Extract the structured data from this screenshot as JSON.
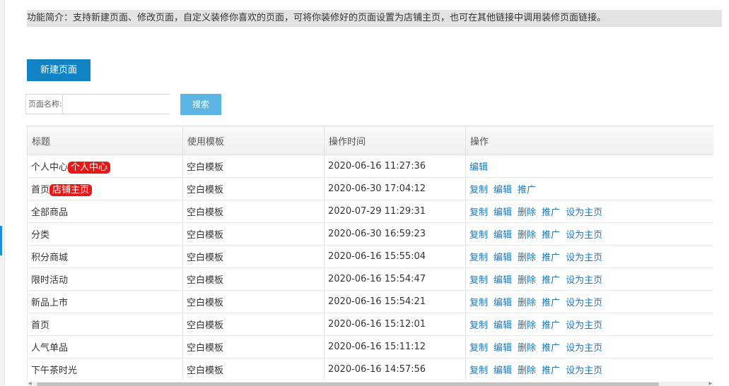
{
  "intro": {
    "text": "功能简介：支持新建页面、修改页面，自定义装修你喜欢的页面，可将你装修好的页面设置为店铺主页，也可在其他链接中调用装修页面链接。"
  },
  "toolbar": {
    "new_page_label": "新建页面"
  },
  "search": {
    "label": "页面名称:",
    "value": "",
    "button_label": "搜索"
  },
  "table": {
    "headers": {
      "title": "标题",
      "template": "使用模板",
      "time": "操作时间",
      "ops": "操作"
    },
    "rows": [
      {
        "title": "个人中心",
        "badge": "个人中心",
        "template": "空白模板",
        "time": "2020-06-16 11:27:36",
        "ops": [
          "编辑"
        ]
      },
      {
        "title": "首页",
        "badge": "店铺主页",
        "template": "空白模板",
        "time": "2020-06-30 17:04:12",
        "ops": [
          "复制",
          "编辑",
          "推广"
        ]
      },
      {
        "title": "全部商品",
        "badge": "",
        "template": "空白模板",
        "time": "2020-07-29 11:29:31",
        "ops": [
          "复制",
          "编辑",
          "删除",
          "推广",
          "设为主页"
        ]
      },
      {
        "title": "分类",
        "badge": "",
        "template": "空白模板",
        "time": "2020-06-30 16:59:23",
        "ops": [
          "复制",
          "编辑",
          "删除",
          "推广",
          "设为主页"
        ]
      },
      {
        "title": "积分商城",
        "badge": "",
        "template": "空白模板",
        "time": "2020-06-16 15:55:04",
        "ops": [
          "复制",
          "编辑",
          "删除",
          "推广",
          "设为主页"
        ]
      },
      {
        "title": "限时活动",
        "badge": "",
        "template": "空白模板",
        "time": "2020-06-16 15:54:47",
        "ops": [
          "复制",
          "编辑",
          "删除",
          "推广",
          "设为主页"
        ]
      },
      {
        "title": "新品上市",
        "badge": "",
        "template": "空白模板",
        "time": "2020-06-16 15:54:21",
        "ops": [
          "复制",
          "编辑",
          "删除",
          "推广",
          "设为主页"
        ]
      },
      {
        "title": "首页",
        "badge": "",
        "template": "空白模板",
        "time": "2020-06-16 15:12:01",
        "ops": [
          "复制",
          "编辑",
          "删除",
          "推广",
          "设为主页"
        ]
      },
      {
        "title": "人气单品",
        "badge": "",
        "template": "空白模板",
        "time": "2020-06-16 15:11:12",
        "ops": [
          "复制",
          "编辑",
          "删除",
          "推广",
          "设为主页"
        ]
      },
      {
        "title": "下午茶时光",
        "badge": "",
        "template": "空白模板",
        "time": "2020-06-16 14:57:56",
        "ops": [
          "复制",
          "编辑",
          "删除",
          "推广",
          "设为主页"
        ]
      }
    ]
  },
  "colors": {
    "primary_button": "#1182c3",
    "search_button": "#5bb4e1",
    "badge": "#e31a1a",
    "link": "#1a78b8"
  }
}
